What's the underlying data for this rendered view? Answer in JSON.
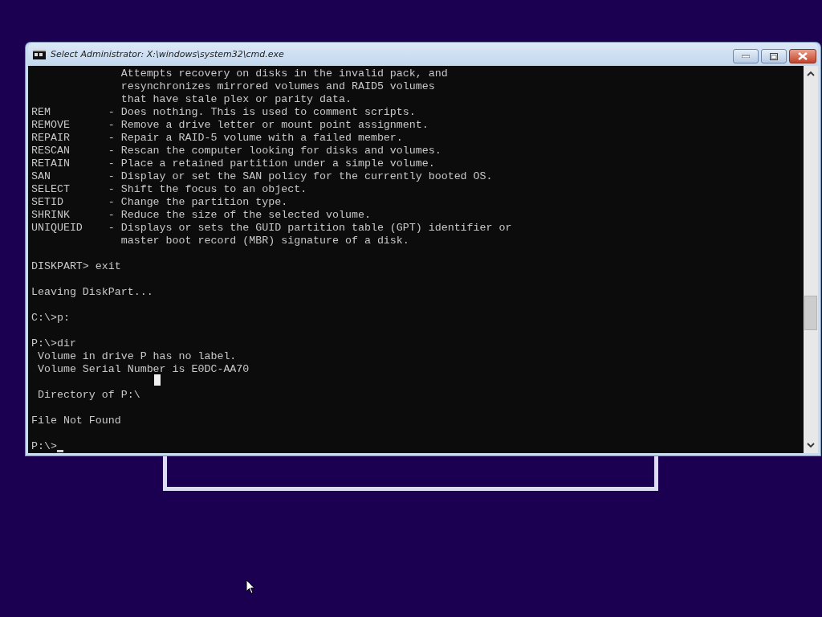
{
  "window": {
    "title": "Select Administrator: X:\\windows\\system32\\cmd.exe"
  },
  "console": {
    "blocks": [
      [
        "              Attempts recovery on disks in the invalid pack, and",
        "              resynchronizes mirrored volumes and RAID5 volumes",
        "              that have stale plex or parity data.",
        "REM         - Does nothing. This is used to comment scripts.",
        "REMOVE      - Remove a drive letter or mount point assignment.",
        "REPAIR      - Repair a RAID-5 volume with a failed member.",
        "RESCAN      - Rescan the computer looking for disks and volumes.",
        "RETAIN      - Place a retained partition under a simple volume.",
        "SAN         - Display or set the SAN policy for the currently booted OS.",
        "SELECT      - Shift the focus to an object.",
        "SETID       - Change the partition type.",
        "SHRINK      - Reduce the size of the selected volume.",
        "UNIQUEID    - Displays or sets the GUID partition table (GPT) identifier or",
        "              master boot record (MBR) signature of a disk."
      ],
      [
        "DISKPART> exit"
      ],
      [
        "Leaving DiskPart..."
      ],
      [
        "C:\\>p:"
      ],
      [
        "P:\\>dir",
        " Volume in drive P has no label.",
        " Volume Serial Number is E0DC-AA70"
      ],
      [
        " Directory of P:\\"
      ],
      [
        "File Not Found"
      ]
    ],
    "prompt": "P:\\>"
  }
}
